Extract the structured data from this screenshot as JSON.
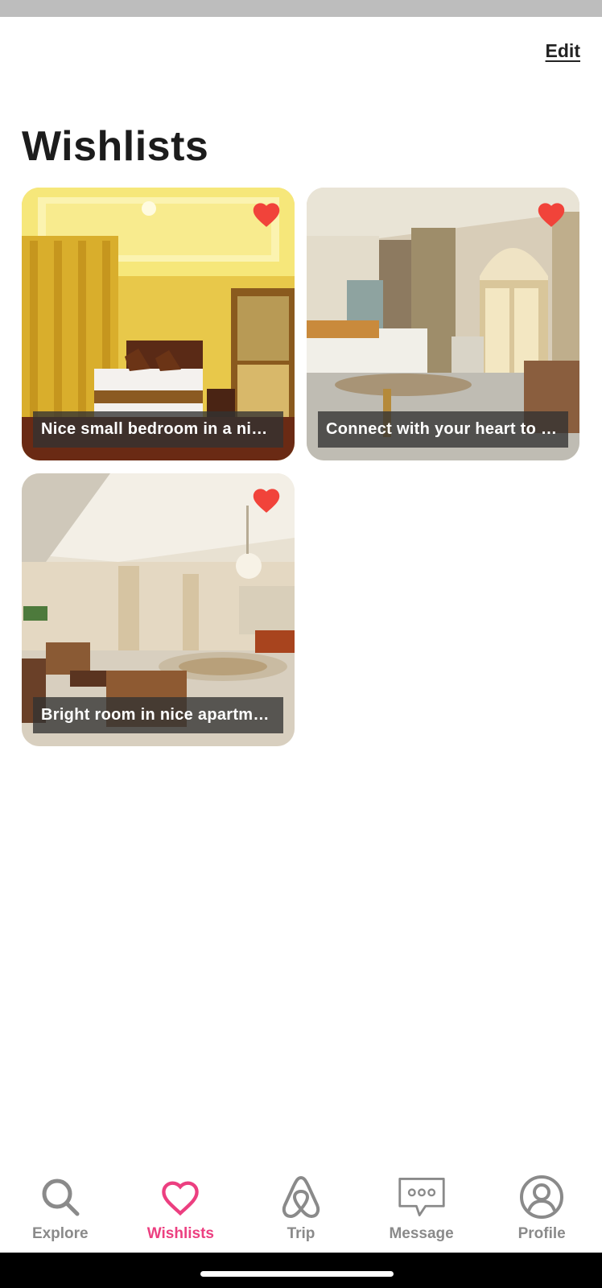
{
  "header": {
    "edit_label": "Edit",
    "title": "Wishlists"
  },
  "wishlists": [
    {
      "label": "Nice small bedroom in a nic…",
      "saved": true
    },
    {
      "label": "Connect with your heart to …",
      "saved": true
    },
    {
      "label": "Bright room in nice apartm…",
      "saved": true
    }
  ],
  "bottom_nav": {
    "items": [
      {
        "label": "Explore",
        "icon": "search-icon",
        "active": false
      },
      {
        "label": "Wishlists",
        "icon": "heart-outline-icon",
        "active": true
      },
      {
        "label": "Trip",
        "icon": "airbnb-logo-icon",
        "active": false
      },
      {
        "label": "Message",
        "icon": "chat-bubble-icon",
        "active": false
      },
      {
        "label": "Profile",
        "icon": "user-circle-icon",
        "active": false
      }
    ]
  },
  "colors": {
    "accent": "#ec3f80",
    "heart": "#f1433a",
    "inactive_nav": "#8a8a8a"
  }
}
